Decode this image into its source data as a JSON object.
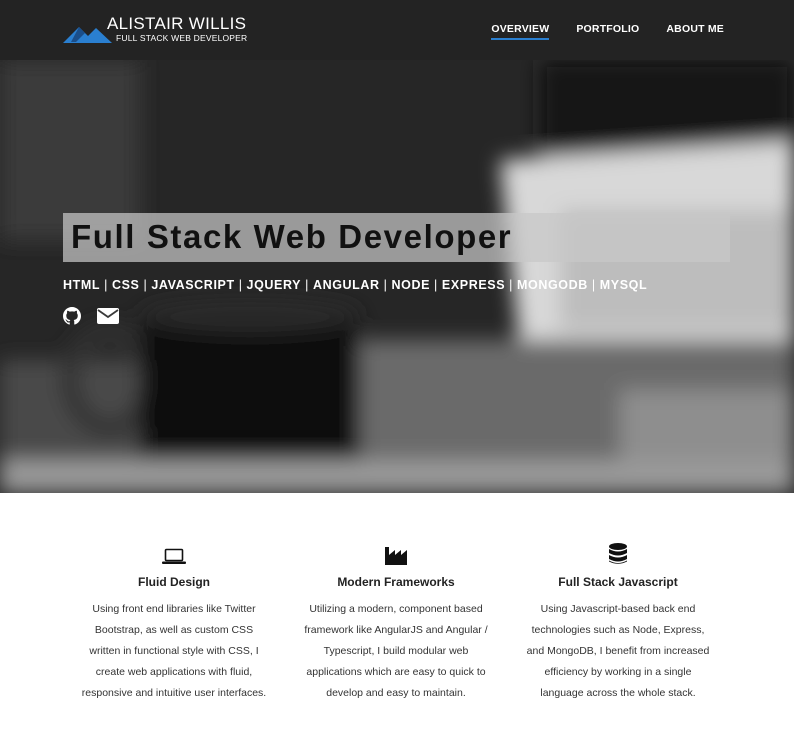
{
  "brand": {
    "name": "ALISTAIR WILLIS",
    "subtitle": "FULL STACK WEB DEVELOPER",
    "colors": {
      "mountain_blue": "#2a7fd0",
      "mountain_dark": "#1a4e8a"
    }
  },
  "nav": {
    "items": [
      {
        "label": "OVERVIEW",
        "active": true
      },
      {
        "label": "PORTFOLIO",
        "active": false
      },
      {
        "label": "ABOUT ME",
        "active": false
      }
    ],
    "accent": "#2a7fd0"
  },
  "hero": {
    "title": "Full Stack Web Developer",
    "skills": [
      "HTML",
      "CSS",
      "JAVASCRIPT",
      "JQUERY",
      "ANGULAR",
      "NODE",
      "EXPRESS",
      "MONGODB",
      "MYSQL"
    ],
    "skill_separator": "|",
    "social": [
      {
        "icon": "github-icon"
      },
      {
        "icon": "envelope-icon"
      }
    ]
  },
  "features": [
    {
      "icon": "laptop-icon",
      "title": "Fluid Design",
      "lines": [
        "Using front end libraries like Twitter",
        "Bootstrap, as well as custom CSS",
        "written in functional style with CSS, I",
        "create web applications with fluid,",
        "responsive and intuitive user interfaces."
      ]
    },
    {
      "icon": "industry-icon",
      "title": "Modern Frameworks",
      "lines": [
        "Utilizing a modern, component based",
        "framework like AngularJS and Angular /",
        "Typescript, I build modular web",
        "applications which are easy to quick to",
        "develop and easy to maintain."
      ]
    },
    {
      "icon": "database-icon",
      "title": "Full Stack Javascript",
      "lines": [
        "Using Javascript-based back end",
        "technologies such as Node, Express,",
        "and MongoDB, I benefit from increased",
        "efficiency by working in a single",
        "language across the whole stack."
      ]
    }
  ]
}
